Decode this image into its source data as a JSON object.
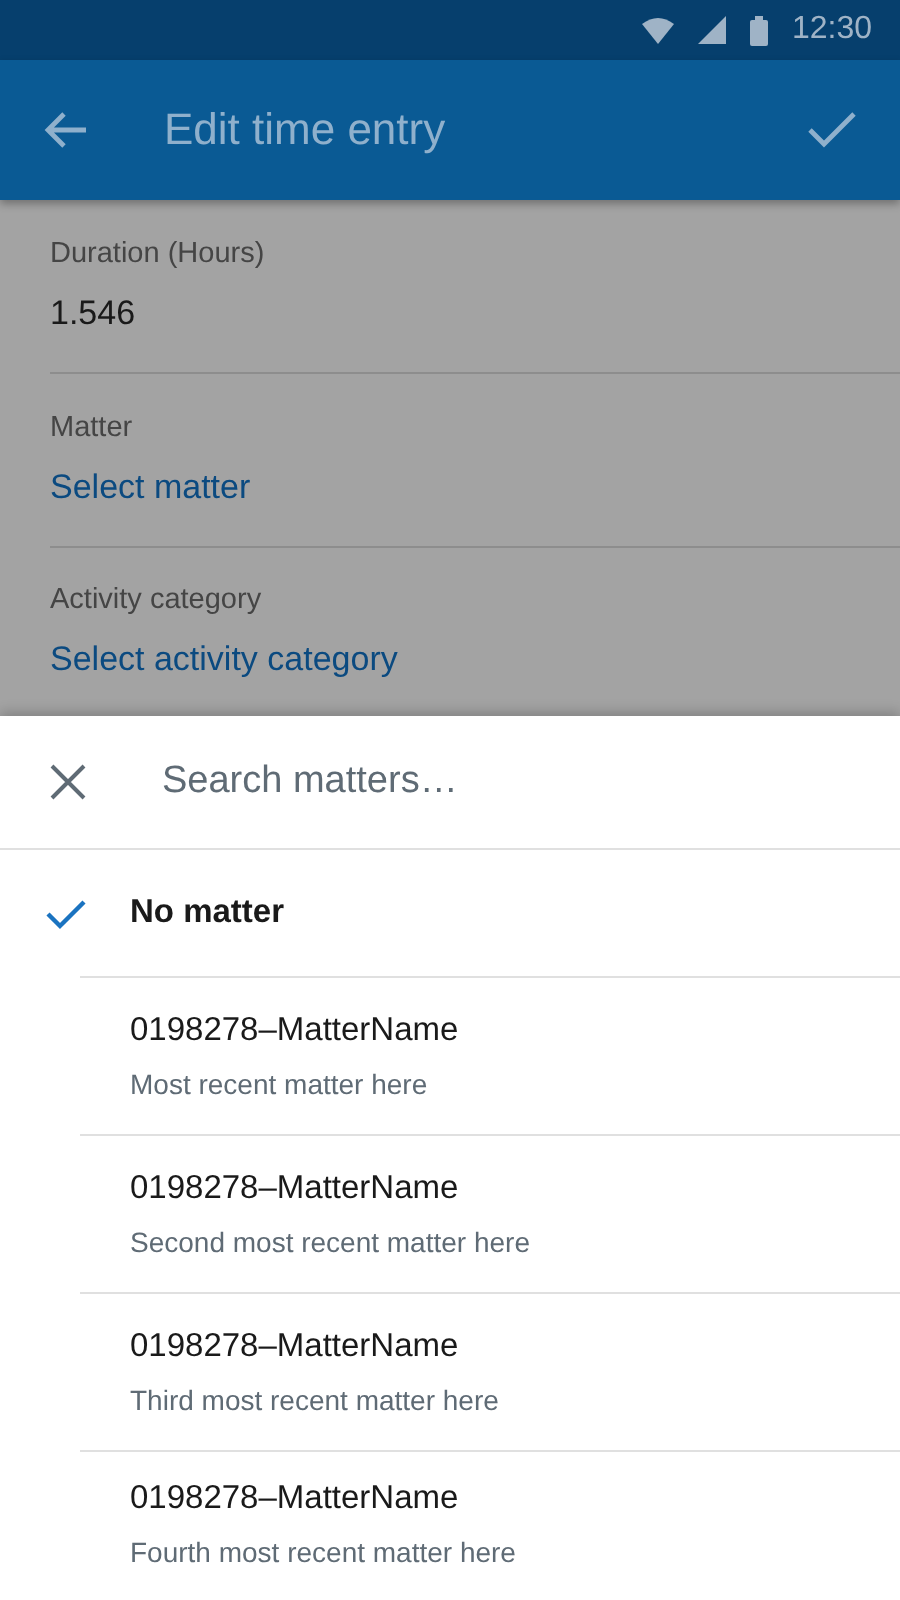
{
  "status_bar": {
    "time": "12:30"
  },
  "app_bar": {
    "title": "Edit time entry"
  },
  "fields": [
    {
      "label": "Duration (Hours)",
      "kind": "value",
      "value": "1.546"
    },
    {
      "label": "Matter",
      "kind": "link",
      "value": "Select matter"
    },
    {
      "label": "Activity category",
      "kind": "link",
      "value": "Select activity category"
    }
  ],
  "sheet": {
    "search": {
      "placeholder": "Search matters…"
    },
    "items": [
      {
        "title": "No matter",
        "selected": true
      },
      {
        "title": "0198278–MatterName",
        "subtitle": "Most recent matter here",
        "selected": false
      },
      {
        "title": "0198278–MatterName",
        "subtitle": "Second most recent matter here",
        "selected": false
      },
      {
        "title": "0198278–MatterName",
        "subtitle": "Third most recent matter here",
        "selected": false
      },
      {
        "title": "0198278–MatterName",
        "subtitle": "Fourth most recent matter here",
        "selected": false
      }
    ]
  }
}
